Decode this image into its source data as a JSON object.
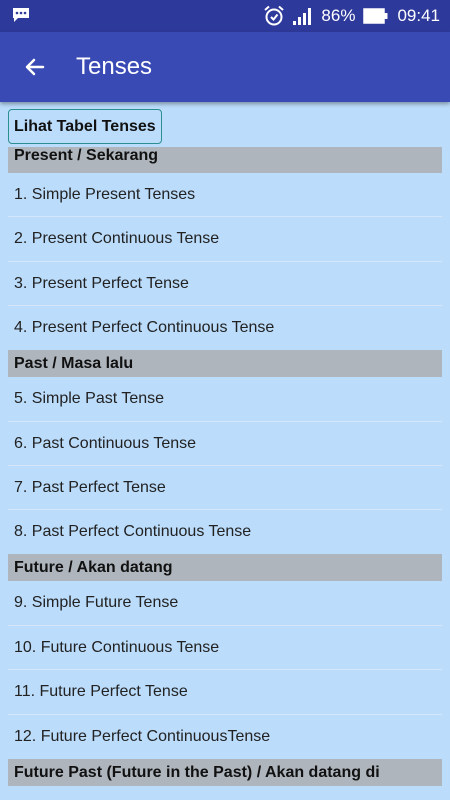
{
  "status_bar": {
    "battery_percent": "86%",
    "time": "09:41",
    "icons": [
      "message-icon",
      "alarm-icon",
      "signal-icon",
      "battery-icon"
    ]
  },
  "app_bar": {
    "title": "Tenses",
    "back_icon": "arrow-left-icon"
  },
  "table_button": {
    "label": "Lihat Tabel Tenses"
  },
  "sections": [
    {
      "header": "Present / Sekarang",
      "items": [
        "1. Simple Present Tenses",
        "2. Present Continuous Tense",
        "3. Present Perfect Tense",
        "4. Present Perfect Continuous Tense"
      ]
    },
    {
      "header": "Past / Masa lalu",
      "items": [
        "5. Simple Past Tense",
        "6. Past Continuous Tense",
        "7. Past Perfect Tense",
        "8. Past Perfect Continuous Tense"
      ]
    },
    {
      "header": "Future / Akan datang",
      "items": [
        "9. Simple Future Tense",
        "10. Future Continuous Tense",
        "11. Future Perfect Tense",
        "12. Future Perfect ContinuousTense"
      ]
    },
    {
      "header": "Future Past (Future in the Past) / Akan datang di",
      "items": []
    }
  ],
  "colors": {
    "status_bar": "#2e3a9b",
    "app_bar": "#3a4ab5",
    "background": "#bbdcfb",
    "section_header": "#aeb5bd",
    "button_border": "#2a8f8f"
  }
}
